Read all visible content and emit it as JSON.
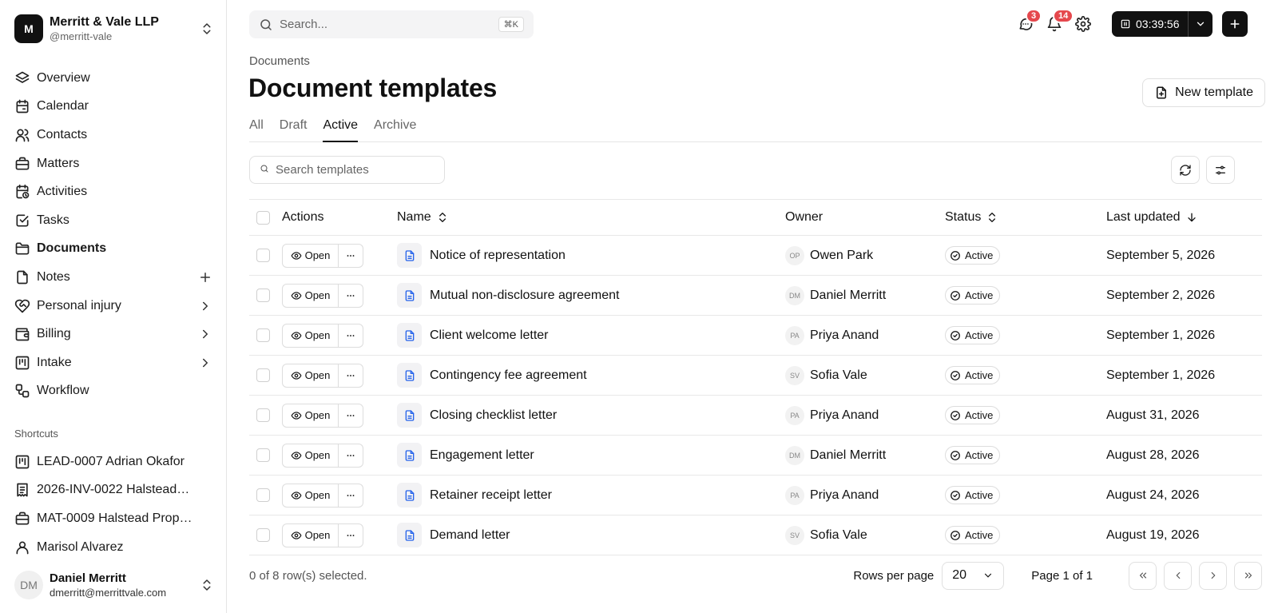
{
  "org": {
    "initial": "M",
    "name": "Merritt & Vale LLP",
    "handle": "@merritt-vale"
  },
  "nav": {
    "items": [
      {
        "label": "Overview",
        "icon": "layers-icon"
      },
      {
        "label": "Calendar",
        "icon": "calendar-icon"
      },
      {
        "label": "Contacts",
        "icon": "users-icon"
      },
      {
        "label": "Matters",
        "icon": "briefcase-icon"
      },
      {
        "label": "Activities",
        "icon": "clock-calendar-icon"
      },
      {
        "label": "Tasks",
        "icon": "check-square-icon"
      },
      {
        "label": "Documents",
        "icon": "folder-icon",
        "active": true
      },
      {
        "label": "Notes",
        "icon": "file-icon",
        "trailing": "plus-icon"
      },
      {
        "label": "Personal injury",
        "icon": "heart-handshake-icon",
        "trailing": "chevron-right-icon"
      },
      {
        "label": "Billing",
        "icon": "wallet-icon",
        "trailing": "chevron-right-icon"
      },
      {
        "label": "Intake",
        "icon": "kanban-icon",
        "trailing": "chevron-right-icon"
      },
      {
        "label": "Workflow",
        "icon": "workflow-icon"
      }
    ]
  },
  "shortcuts": {
    "title": "Shortcuts",
    "items": [
      {
        "label": "LEAD-0007 Adrian Okafor",
        "icon": "kanban-icon"
      },
      {
        "label": "2026-INV-0022 Halstead…",
        "icon": "receipt-icon"
      },
      {
        "label": "MAT-0009 Halstead Prop…",
        "icon": "briefcase-icon"
      },
      {
        "label": "Marisol Alvarez",
        "icon": "user-icon"
      }
    ]
  },
  "user": {
    "initials": "DM",
    "name": "Daniel Merritt",
    "email": "dmerritt@merrittvale.com"
  },
  "topbar": {
    "search_placeholder": "Search...",
    "shortcut": "⌘K",
    "messages_count": "3",
    "notifications_count": "14",
    "timer": "03:39:56"
  },
  "breadcrumb": "Documents",
  "title": "Document templates",
  "new_template_label": "New template",
  "tabs": [
    {
      "label": "All"
    },
    {
      "label": "Draft"
    },
    {
      "label": "Active",
      "active": true
    },
    {
      "label": "Archive"
    }
  ],
  "table_search_placeholder": "Search templates",
  "columns": {
    "actions": "Actions",
    "name": "Name",
    "owner": "Owner",
    "status": "Status",
    "updated": "Last updated"
  },
  "open_label": "Open",
  "rows": [
    {
      "name": "Notice of representation",
      "owner_initials": "OP",
      "owner": "Owen Park",
      "status": "Active",
      "updated": "September 5, 2026"
    },
    {
      "name": "Mutual non-disclosure agreement",
      "owner_initials": "DM",
      "owner": "Daniel Merritt",
      "status": "Active",
      "updated": "September 2, 2026"
    },
    {
      "name": "Client welcome letter",
      "owner_initials": "PA",
      "owner": "Priya Anand",
      "status": "Active",
      "updated": "September 1, 2026"
    },
    {
      "name": "Contingency fee agreement",
      "owner_initials": "SV",
      "owner": "Sofia Vale",
      "status": "Active",
      "updated": "September 1, 2026"
    },
    {
      "name": "Closing checklist letter",
      "owner_initials": "PA",
      "owner": "Priya Anand",
      "status": "Active",
      "updated": "August 31, 2026"
    },
    {
      "name": "Engagement letter",
      "owner_initials": "DM",
      "owner": "Daniel Merritt",
      "status": "Active",
      "updated": "August 28, 2026"
    },
    {
      "name": "Retainer receipt letter",
      "owner_initials": "PA",
      "owner": "Priya Anand",
      "status": "Active",
      "updated": "August 24, 2026"
    },
    {
      "name": "Demand letter",
      "owner_initials": "SV",
      "owner": "Sofia Vale",
      "status": "Active",
      "updated": "August 19, 2026"
    }
  ],
  "footer": {
    "selection": "0 of 8 row(s) selected.",
    "rows_per_page_label": "Rows per page",
    "rows_per_page": "20",
    "page_info": "Page 1 of 1"
  }
}
